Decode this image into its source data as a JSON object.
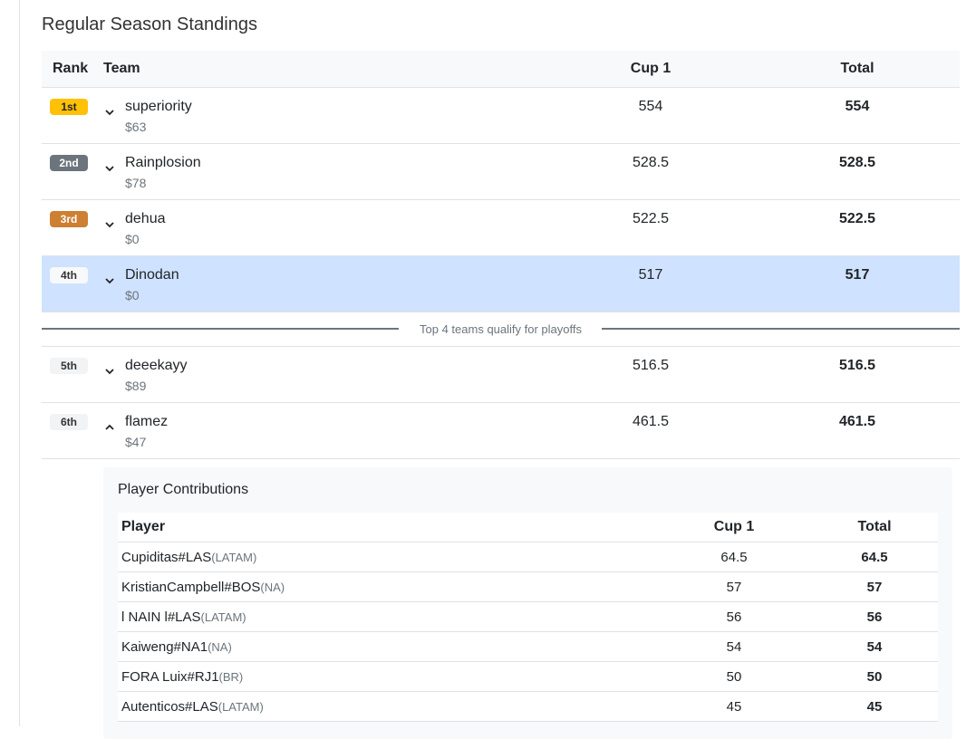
{
  "title": "Regular Season Standings",
  "headers": {
    "rank": "Rank",
    "team": "Team",
    "cup": "Cup 1",
    "total": "Total"
  },
  "standings": [
    {
      "rank": "1st",
      "team": "superiority",
      "price": "$63",
      "cup": "554",
      "total": "554"
    },
    {
      "rank": "2nd",
      "team": "Rainplosion",
      "price": "$78",
      "cup": "528.5",
      "total": "528.5"
    },
    {
      "rank": "3rd",
      "team": "dehua",
      "price": "$0",
      "cup": "522.5",
      "total": "522.5"
    },
    {
      "rank": "4th",
      "team": "Dinodan",
      "price": "$0",
      "cup": "517",
      "total": "517"
    },
    {
      "rank": "5th",
      "team": "deeekayy",
      "price": "$89",
      "cup": "516.5",
      "total": "516.5"
    },
    {
      "rank": "6th",
      "team": "flamez",
      "price": "$47",
      "cup": "461.5",
      "total": "461.5"
    }
  ],
  "divider_text": "Top 4 teams qualify for playoffs",
  "contributions": {
    "title": "Player Contributions",
    "headers": {
      "player": "Player",
      "cup": "Cup 1",
      "total": "Total"
    },
    "rows": [
      {
        "player": "Cupiditas#LAS",
        "region": "(LATAM)",
        "cup": "64.5",
        "total": "64.5"
      },
      {
        "player": "KristianCampbell#BOS",
        "region": "(NA)",
        "cup": "57",
        "total": "57"
      },
      {
        "player": "l NAIN l#LAS",
        "region": "(LATAM)",
        "cup": "56",
        "total": "56"
      },
      {
        "player": "Kaiweng#NA1",
        "region": "(NA)",
        "cup": "54",
        "total": "54"
      },
      {
        "player": "FORA Luix#RJ1",
        "region": "(BR)",
        "cup": "50",
        "total": "50"
      },
      {
        "player": "Autenticos#LAS",
        "region": "(LATAM)",
        "cup": "45",
        "total": "45"
      }
    ]
  },
  "colors": {
    "gold": "#ffc107",
    "silver": "#6c757d",
    "bronze": "#cd7f32",
    "highlight": "#cfe2ff"
  },
  "icons": {
    "collapsed": "chevron-down-icon",
    "expanded": "chevron-up-icon"
  }
}
